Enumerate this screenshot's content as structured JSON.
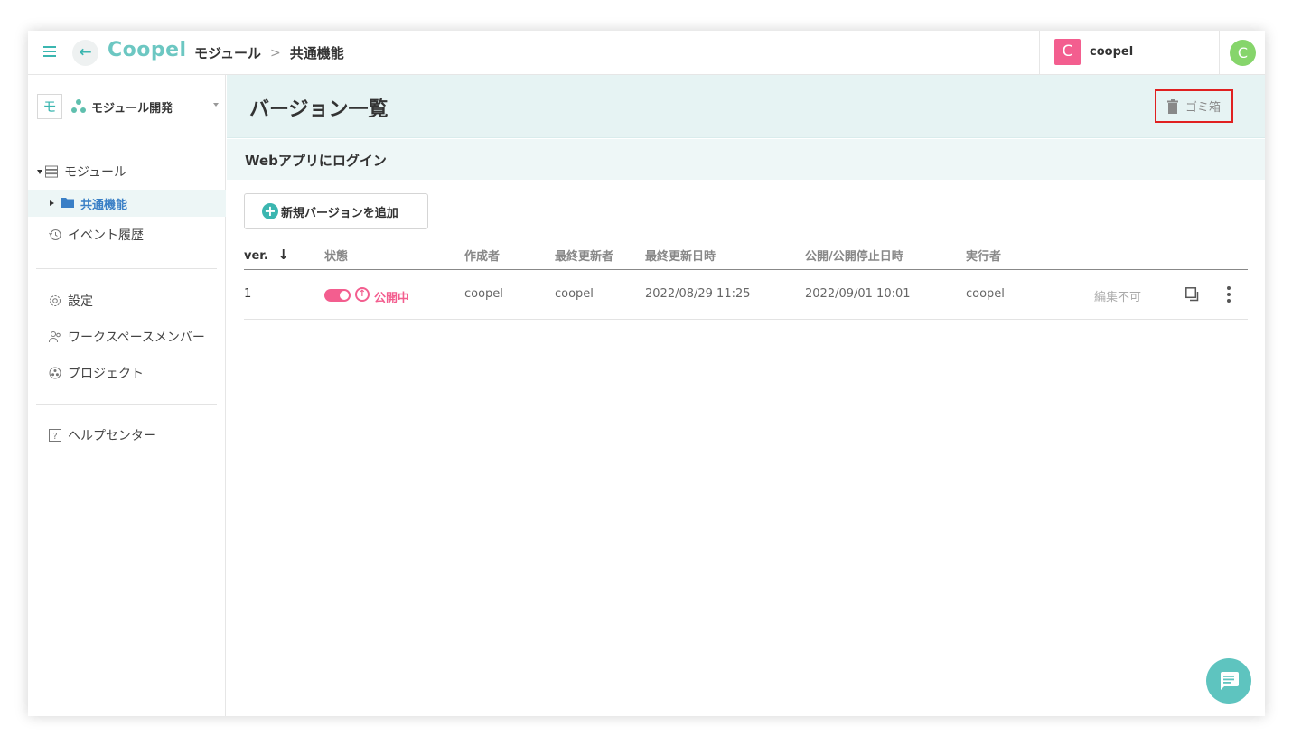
{
  "header": {
    "logo": "Coopel",
    "breadcrumb": [
      "モジュール",
      "共通機能"
    ],
    "workspace_initial": "C",
    "workspace_name": "coopel",
    "user_initial": "C"
  },
  "sidebar": {
    "project_initial": "モ",
    "project_name": "モジュール開発",
    "items": [
      {
        "label": "モジュール",
        "icon": "server-icon"
      },
      {
        "label": "共通機能",
        "icon": "folder-icon"
      },
      {
        "label": "イベント履歴",
        "icon": "history-icon"
      },
      {
        "label": "設定",
        "icon": "gear-icon"
      },
      {
        "label": "ワークスペースメンバー",
        "icon": "members-icon"
      },
      {
        "label": "プロジェクト",
        "icon": "project-icon"
      },
      {
        "label": "ヘルプセンター",
        "icon": "help-icon"
      }
    ]
  },
  "main": {
    "title": "バージョン一覧",
    "trash_label": "ゴミ箱",
    "subtitle": "Webアプリにログイン",
    "add_button_label": "新規バージョンを追加",
    "columns": [
      "ver.",
      "状態",
      "作成者",
      "最終更新者",
      "最終更新日時",
      "公開/公開停止日時",
      "実行者"
    ],
    "rows": [
      {
        "ver": "1",
        "status": "公開中",
        "creator": "coopel",
        "updater": "coopel",
        "updated_at": "2022/08/29 11:25",
        "published_at": "2022/09/01 10:01",
        "executor": "coopel",
        "edit_state": "編集不可"
      }
    ]
  },
  "colors": {
    "accent": "#3bb6b0",
    "status_pink": "#f35e8f",
    "highlight_border": "#e02020"
  }
}
